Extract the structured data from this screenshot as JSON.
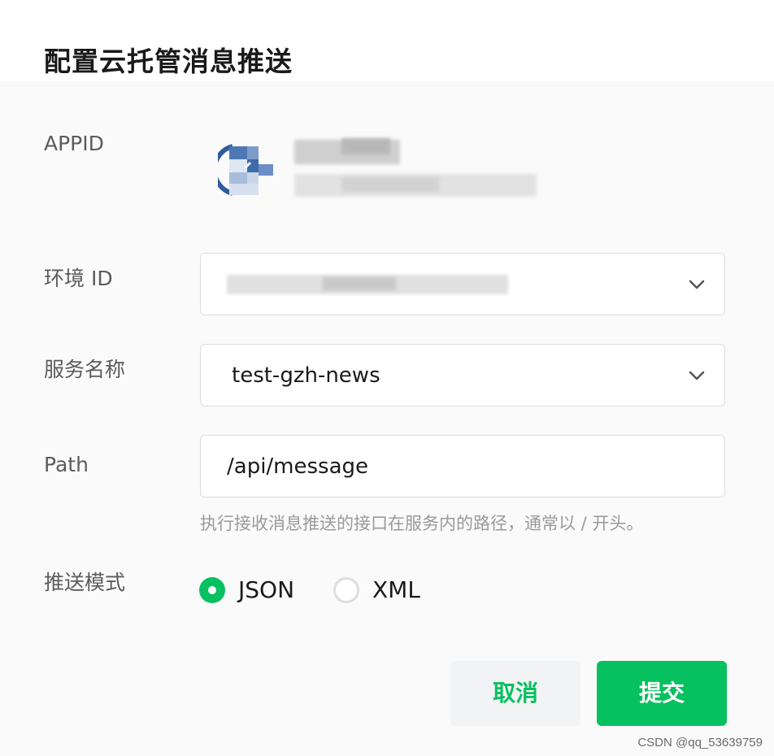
{
  "dialog": {
    "title": "配置云托管消息推送"
  },
  "form": {
    "appid": {
      "label": "APPID",
      "avatar_icon": "mini-program-avatar-icon"
    },
    "env": {
      "label": "环境 ID",
      "value": "",
      "icon": "chevron-down-icon"
    },
    "service": {
      "label": "服务名称",
      "value": "test-gzh-news",
      "icon": "chevron-down-icon"
    },
    "path": {
      "label": "Path",
      "value": "/api/message",
      "hint": "执行接收消息推送的接口在服务内的路径，通常以 / 开头。"
    },
    "mode": {
      "label": "推送模式",
      "options": [
        {
          "label": "JSON",
          "checked": true
        },
        {
          "label": "XML",
          "checked": false
        }
      ]
    }
  },
  "actions": {
    "cancel_label": "取消",
    "submit_label": "提交"
  },
  "watermark": "CSDN @qq_53639759",
  "colors": {
    "accent": "#07c160",
    "cancel_bg": "#f2f3f5"
  }
}
